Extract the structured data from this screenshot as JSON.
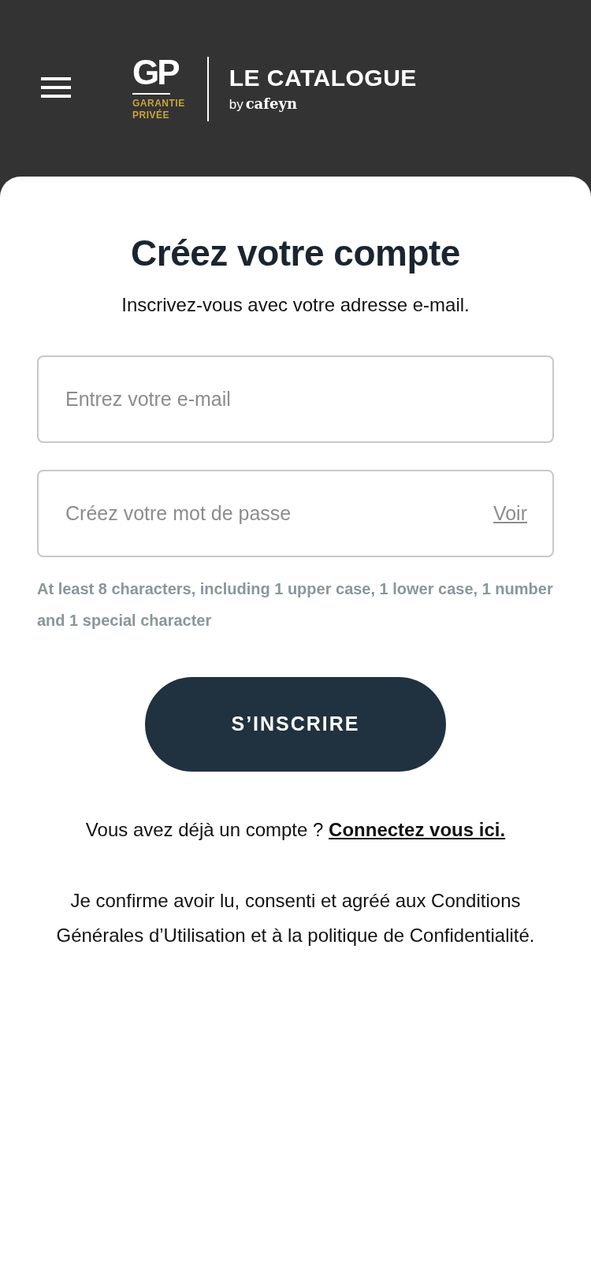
{
  "header": {
    "logo": {
      "monogram": "GP",
      "brand_lines": [
        "GARANTIE",
        "PRIVÉE"
      ],
      "title": "LE CATALOGUE",
      "by": "by",
      "partner": "cafeyn"
    }
  },
  "form": {
    "title": "Créez votre compte",
    "subtitle": "Inscrivez-vous avec votre adresse e-mail.",
    "fields": [
      {
        "placeholder": "Entrez votre e-mail"
      },
      {
        "placeholder": "Créez votre mot de passe",
        "toggle": "Voir"
      }
    ],
    "hint": "At least 8 characters, including 1 upper case, 1 lower case, 1 number and 1 special character",
    "submit": "S’INSCRIRE",
    "login_prompt": "Vous avez déjà un compte ?",
    "login_link": "Connectez vous ici.",
    "terms": "Je confirme avoir lu, consenti et agréé aux Conditions Générales d’Utilisation et à la politique de Confidentialité."
  }
}
